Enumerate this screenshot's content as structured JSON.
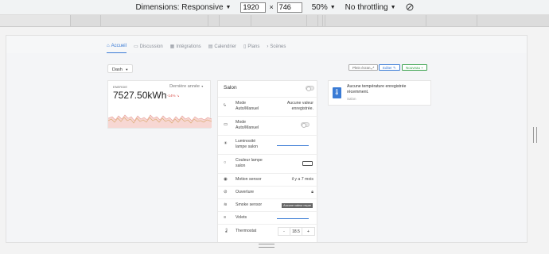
{
  "devtools": {
    "dimensions_label": "Dimensions: Responsive",
    "width": "1920",
    "height": "746",
    "times": "×",
    "zoom": "50%",
    "throttling": "No throttling",
    "rotate_icon": "rotate-icon"
  },
  "tabs": [
    {
      "label": "Accueil",
      "icon": "home-icon"
    },
    {
      "label": "Discussion",
      "icon": "chat-icon"
    },
    {
      "label": "Intégrations",
      "icon": "grid-icon"
    },
    {
      "label": "Calendrier",
      "icon": "calendar-icon"
    },
    {
      "label": "Plans",
      "icon": "map-icon"
    },
    {
      "label": "Scènes",
      "icon": "scenes-icon"
    }
  ],
  "toolbar": {
    "dash_label": "Dash",
    "plein_ecran": "Plein écran",
    "editer": "Editer",
    "nouveau": "Nouveau"
  },
  "energy": {
    "label": "ENERGIE",
    "period": "Dernière année",
    "value": "7527.50kWh",
    "delta": "-14%",
    "colors": {
      "fill": "#f7d7d3",
      "line_a": "#e8a09a",
      "line_b": "#d9a86a"
    }
  },
  "devices": {
    "title": "Salon",
    "rows": [
      {
        "label": "Mode Auto/Manuel",
        "icon": "bolt-icon",
        "value": "Aucune valeur enregistrée."
      },
      {
        "label": "Mode Auto/Manuel",
        "icon": "camera-icon",
        "control": "toggle"
      },
      {
        "label": "Luminosité lampe salon",
        "icon": "sun-icon",
        "control": "slider"
      },
      {
        "label": "Couleur lampe salon",
        "icon": "circle-icon",
        "control": "color"
      },
      {
        "label": "Motion sensor",
        "icon": "motion-icon",
        "value": "il y a 7 mois"
      },
      {
        "label": "Ouverture",
        "icon": "door-icon",
        "control": "lock"
      },
      {
        "label": "Smoke sensor",
        "icon": "smoke-icon",
        "badge": "Aucune valeur reçue"
      },
      {
        "label": "Volets",
        "icon": "shutter-icon",
        "control": "slider"
      },
      {
        "label": "Thermostat",
        "icon": "thermometer-icon",
        "stepper": {
          "minus": "-",
          "value": "18.5",
          "plus": "+"
        }
      }
    ]
  },
  "temperature": {
    "icon": "thermometer-icon",
    "text": "Aucune température enregistrée récemment.",
    "sub": "Salon"
  }
}
